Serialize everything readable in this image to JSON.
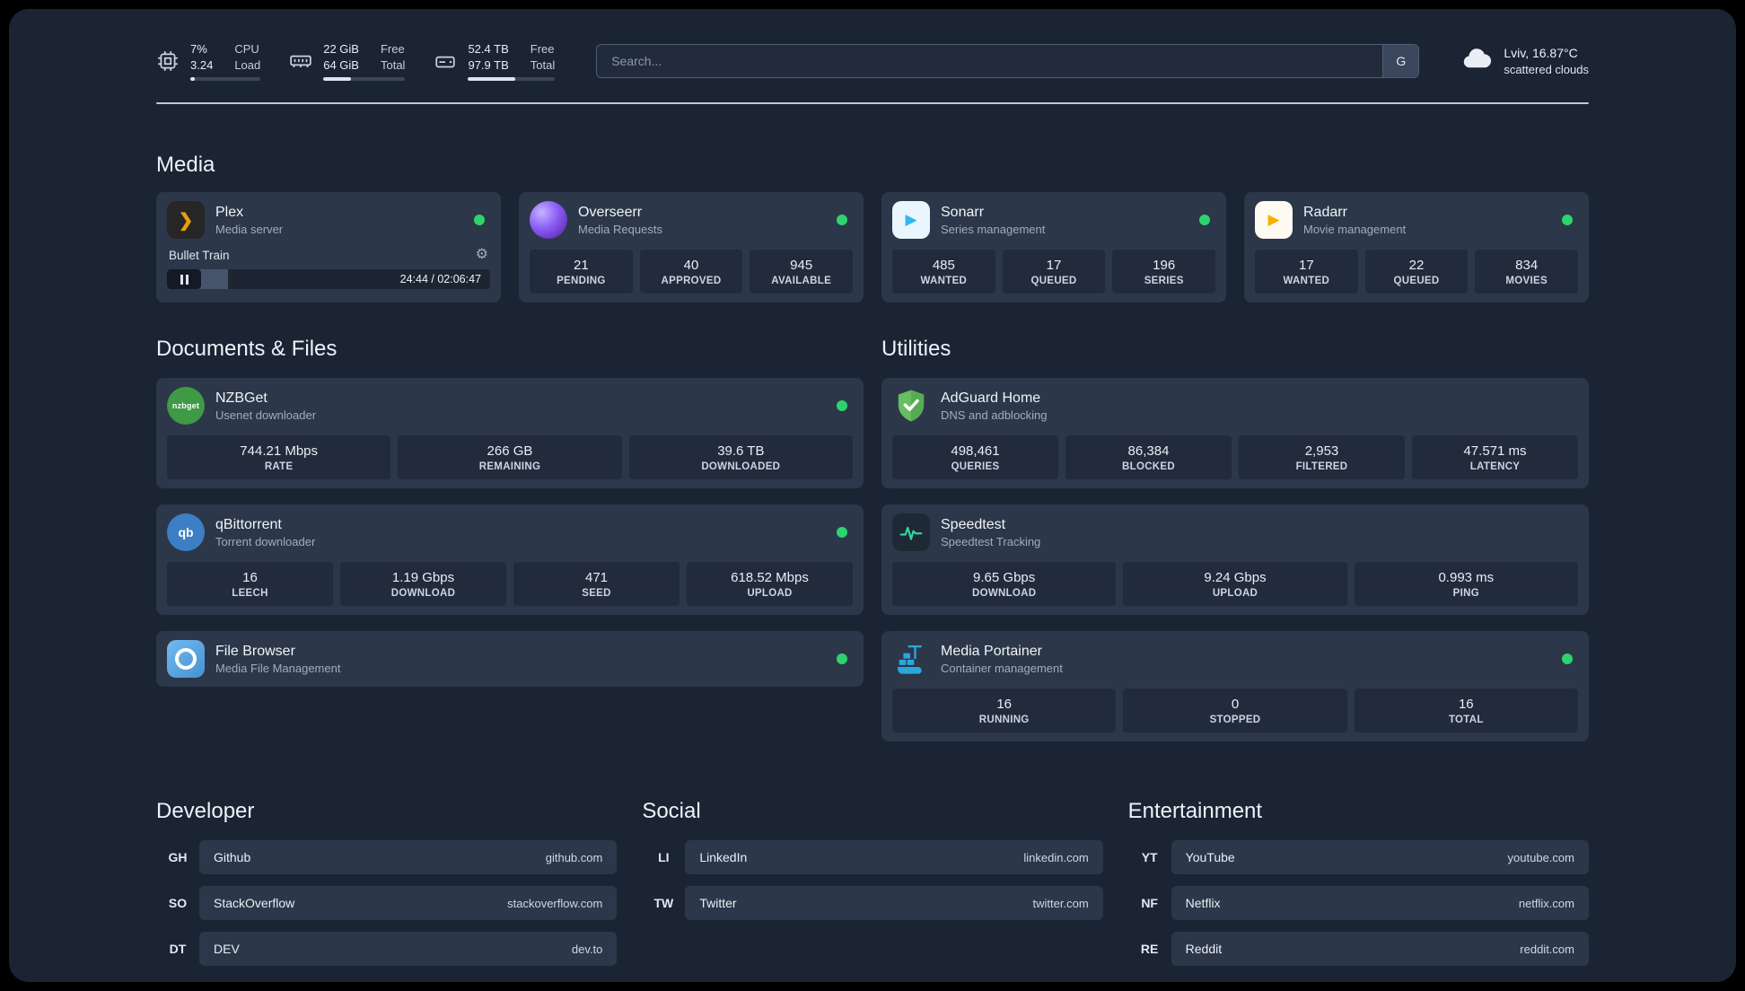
{
  "colors": {
    "background": "#1b2433",
    "card": "#2c3749",
    "stat_box": "#222b3b",
    "status_green": "#2dd36f",
    "plex_gold": "#e5a00d",
    "adguard_green": "#68bd63",
    "portainer_blue": "#2aa7dd",
    "speedtest_green": "#34d399"
  },
  "topbar": {
    "cpu": {
      "value1": "7%",
      "value2": "3.24",
      "label1": "CPU",
      "label2": "Load",
      "bar_percent": 7
    },
    "ram": {
      "value1": "22 GiB",
      "value2": "64 GiB",
      "label1": "Free",
      "label2": "Total",
      "bar_percent": 34
    },
    "disk": {
      "value1": "52.4 TB",
      "value2": "97.9 TB",
      "label1": "Free",
      "label2": "Total",
      "bar_percent": 54
    },
    "search": {
      "placeholder": "Search...",
      "provider": "G"
    },
    "weather": {
      "location": "Lviv, 16.87°C",
      "condition": "scattered clouds"
    }
  },
  "media": {
    "heading": "Media",
    "plex": {
      "name": "Plex",
      "desc": "Media server",
      "icon_text": "❯",
      "now_playing": {
        "title": "Bullet Train",
        "time": "24:44 / 02:06:47",
        "progress_percent": 19
      }
    },
    "overseerr": {
      "name": "Overseerr",
      "desc": "Media Requests",
      "stats": [
        {
          "value": "21",
          "label": "PENDING"
        },
        {
          "value": "40",
          "label": "APPROVED"
        },
        {
          "value": "945",
          "label": "AVAILABLE"
        }
      ]
    },
    "sonarr": {
      "name": "Sonarr",
      "desc": "Series management",
      "icon_text": "▶",
      "stats": [
        {
          "value": "485",
          "label": "WANTED"
        },
        {
          "value": "17",
          "label": "QUEUED"
        },
        {
          "value": "196",
          "label": "SERIES"
        }
      ]
    },
    "radarr": {
      "name": "Radarr",
      "desc": "Movie management",
      "icon_text": "▶",
      "stats": [
        {
          "value": "17",
          "label": "WANTED"
        },
        {
          "value": "22",
          "label": "QUEUED"
        },
        {
          "value": "834",
          "label": "MOVIES"
        }
      ]
    }
  },
  "documents": {
    "heading": "Documents & Files",
    "nzbget": {
      "name": "NZBGet",
      "desc": "Usenet downloader",
      "icon_text": "nzbget",
      "stats": [
        {
          "value": "744.21 Mbps",
          "label": "RATE"
        },
        {
          "value": "266 GB",
          "label": "REMAINING"
        },
        {
          "value": "39.6 TB",
          "label": "DOWNLOADED"
        }
      ]
    },
    "qbittorrent": {
      "name": "qBittorrent",
      "desc": "Torrent downloader",
      "icon_text": "qb",
      "stats": [
        {
          "value": "16",
          "label": "LEECH"
        },
        {
          "value": "1.19 Gbps",
          "label": "DOWNLOAD"
        },
        {
          "value": "471",
          "label": "SEED"
        },
        {
          "value": "618.52 Mbps",
          "label": "UPLOAD"
        }
      ]
    },
    "filebrowser": {
      "name": "File Browser",
      "desc": "Media File Management"
    }
  },
  "utilities": {
    "heading": "Utilities",
    "adguard": {
      "name": "AdGuard Home",
      "desc": "DNS and adblocking",
      "stats": [
        {
          "value": "498,461",
          "label": "QUERIES"
        },
        {
          "value": "86,384",
          "label": "BLOCKED"
        },
        {
          "value": "2,953",
          "label": "FILTERED"
        },
        {
          "value": "47.571 ms",
          "label": "LATENCY"
        }
      ]
    },
    "speedtest": {
      "name": "Speedtest",
      "desc": "Speedtest Tracking",
      "stats": [
        {
          "value": "9.65 Gbps",
          "label": "DOWNLOAD"
        },
        {
          "value": "9.24 Gbps",
          "label": "UPLOAD"
        },
        {
          "value": "0.993 ms",
          "label": "PING"
        }
      ]
    },
    "portainer": {
      "name": "Media Portainer",
      "desc": "Container management",
      "stats": [
        {
          "value": "16",
          "label": "RUNNING"
        },
        {
          "value": "0",
          "label": "STOPPED"
        },
        {
          "value": "16",
          "label": "TOTAL"
        }
      ]
    }
  },
  "bookmarks": [
    {
      "heading": "Developer",
      "items": [
        {
          "abbr": "GH",
          "name": "Github",
          "url": "github.com"
        },
        {
          "abbr": "SO",
          "name": "StackOverflow",
          "url": "stackoverflow.com"
        },
        {
          "abbr": "DT",
          "name": "DEV",
          "url": "dev.to"
        }
      ]
    },
    {
      "heading": "Social",
      "items": [
        {
          "abbr": "LI",
          "name": "LinkedIn",
          "url": "linkedin.com"
        },
        {
          "abbr": "TW",
          "name": "Twitter",
          "url": "twitter.com"
        }
      ]
    },
    {
      "heading": "Entertainment",
      "items": [
        {
          "abbr": "YT",
          "name": "YouTube",
          "url": "youtube.com"
        },
        {
          "abbr": "NF",
          "name": "Netflix",
          "url": "netflix.com"
        },
        {
          "abbr": "RE",
          "name": "Reddit",
          "url": "reddit.com"
        }
      ]
    }
  ]
}
